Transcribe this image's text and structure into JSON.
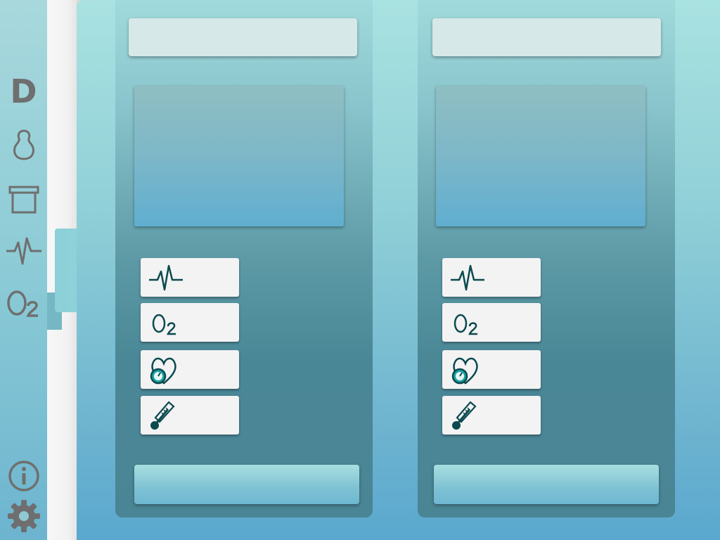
{
  "sidebar": {
    "logo": "D",
    "items": [
      {
        "icon": "person-icon"
      },
      {
        "icon": "archive-box-icon"
      },
      {
        "icon": "pulse-icon"
      },
      {
        "icon": "oxygen-icon",
        "label": "O₂"
      }
    ],
    "footer": [
      {
        "icon": "info-icon"
      },
      {
        "icon": "settings-gear-icon"
      }
    ]
  },
  "panels": [
    {
      "title": "",
      "vitals": [
        {
          "icon": "pulse-icon"
        },
        {
          "icon": "oxygen-icon",
          "label": "O₂"
        },
        {
          "icon": "blood-pressure-heart-icon"
        },
        {
          "icon": "thermometer-icon"
        }
      ],
      "action_label": ""
    },
    {
      "title": "",
      "vitals": [
        {
          "icon": "pulse-icon"
        },
        {
          "icon": "oxygen-icon",
          "label": "O₂"
        },
        {
          "icon": "blood-pressure-heart-icon"
        },
        {
          "icon": "thermometer-icon"
        }
      ],
      "action_label": ""
    }
  ],
  "colors": {
    "icon_dark": "#0b4a4f",
    "icon_gray": "#6f6f6f",
    "accent_teal": "#0f9b9b",
    "card_bg": "#f3f3f3"
  }
}
